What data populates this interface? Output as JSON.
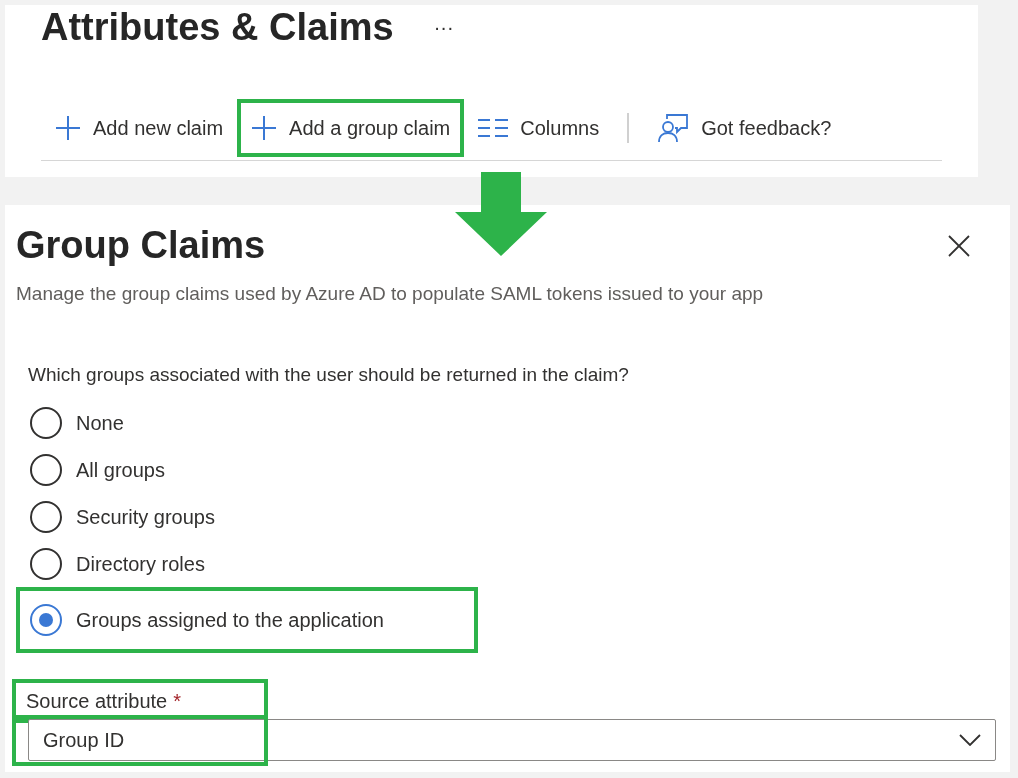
{
  "header": {
    "title": "Attributes & Claims",
    "more": "···"
  },
  "toolbar": [
    {
      "kind": "plus",
      "label": "Add new claim",
      "highlighted": false
    },
    {
      "kind": "plus",
      "label": "Add a group claim",
      "highlighted": true
    },
    {
      "kind": "columns",
      "label": "Columns",
      "highlighted": false
    },
    {
      "kind": "feedback",
      "label": "Got feedback?",
      "highlighted": false
    }
  ],
  "panel": {
    "title": "Group Claims",
    "description": "Manage the group claims used by Azure AD to populate SAML tokens issued to your app",
    "question": "Which groups associated with the user should be returned in the claim?",
    "options": [
      {
        "label": "None",
        "selected": false,
        "highlighted": false
      },
      {
        "label": "All groups",
        "selected": false,
        "highlighted": false
      },
      {
        "label": "Security groups",
        "selected": false,
        "highlighted": false
      },
      {
        "label": "Directory roles",
        "selected": false,
        "highlighted": false
      },
      {
        "label": "Groups assigned to the application",
        "selected": true,
        "highlighted": true
      }
    ],
    "source_attribute": {
      "label": "Source attribute",
      "required_mark": "*",
      "value": "Group ID",
      "label_highlighted": true,
      "value_highlighted": true
    }
  }
}
